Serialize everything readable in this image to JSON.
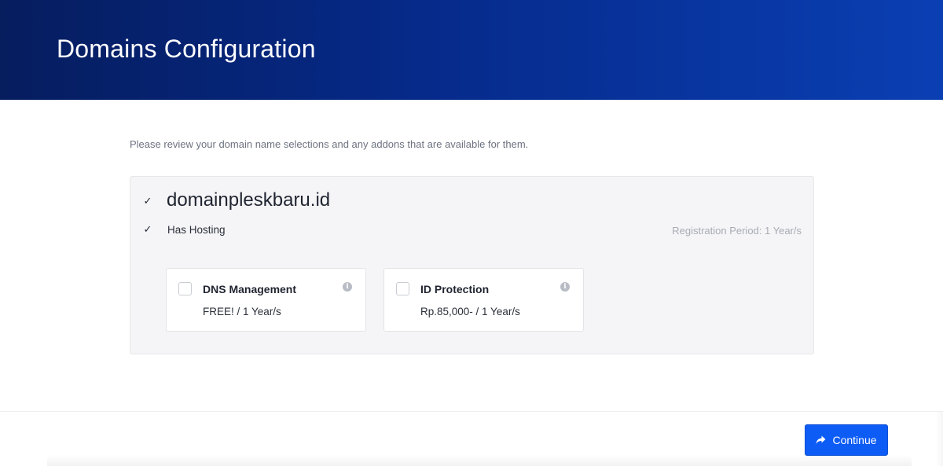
{
  "header": {
    "title": "Domains Configuration"
  },
  "intro": {
    "text": "Please review your domain name selections and any addons that are available for them."
  },
  "domain": {
    "name": "domainpleskbaru.id",
    "checked": true,
    "hosting_label": "Has Hosting",
    "hosting_checked": true,
    "registration_period": "Registration Period: 1 Year/s"
  },
  "addons": [
    {
      "name": "DNS Management",
      "price": "FREE! / 1 Year/s",
      "checked": false,
      "icon": "info-icon"
    },
    {
      "name": "ID Protection",
      "price": "Rp.85,000- / 1 Year/s",
      "checked": false,
      "icon": "info-icon"
    }
  ],
  "footer": {
    "continue_label": "Continue",
    "continue_icon": "share-arrow-icon"
  },
  "colors": {
    "header_start": "#061d5e",
    "header_end": "#0a3fb3",
    "button": "#0d5cf5",
    "panel": "#f5f5f7"
  }
}
